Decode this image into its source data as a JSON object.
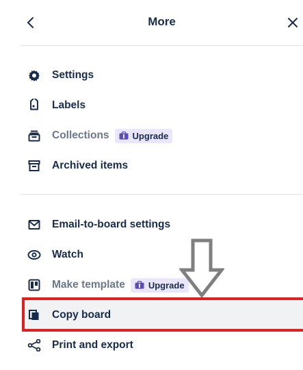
{
  "header": {
    "title": "More",
    "back_icon": "chevron-left-icon",
    "close_icon": "close-icon"
  },
  "menu1": [
    {
      "label": "Settings",
      "icon": "gear-icon"
    },
    {
      "label": "Labels",
      "icon": "tag-icon"
    },
    {
      "label": "Collections",
      "icon": "collections-icon",
      "badge": "Upgrade"
    },
    {
      "label": "Archived items",
      "icon": "archive-icon"
    }
  ],
  "menu2": [
    {
      "label": "Email-to-board settings",
      "icon": "email-icon"
    },
    {
      "label": "Watch",
      "icon": "eye-icon"
    },
    {
      "label": "Make template",
      "icon": "template-icon",
      "badge": "Upgrade"
    },
    {
      "label": "Copy board",
      "icon": "copy-icon"
    },
    {
      "label": "Print and export",
      "icon": "share-icon"
    }
  ],
  "colors": {
    "text": "#172b4d",
    "muted": "#6b778c",
    "badge_bg": "#eae6ff",
    "highlight": "#e02020",
    "arrow": "#7f7f7f"
  }
}
